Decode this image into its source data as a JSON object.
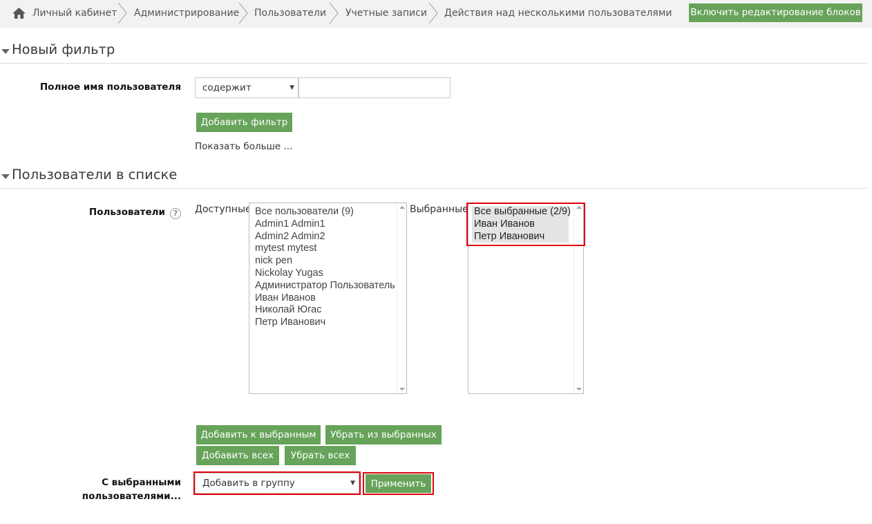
{
  "breadcrumb": {
    "items": [
      "Личный кабинет",
      "Администрирование",
      "Пользователи",
      "Учетные записи",
      "Действия над несколькими пользователями"
    ]
  },
  "header": {
    "edit_blocks_button": "Включить редактирование блоков"
  },
  "filter_section": {
    "title": "Новый фильтр",
    "fullname_label": "Полное имя пользователя",
    "operator_value": "содержит",
    "text_value": "",
    "add_filter_button": "Добавить фильтр",
    "show_more_link": "Показать больше ..."
  },
  "users_section": {
    "title": "Пользователи в списке",
    "users_label": "Пользователи",
    "available_label": "Доступные",
    "available_users": [
      "Все пользователи (9)",
      "Admin1 Admin1",
      "Admin2 Admin2",
      "mytest mytest",
      "nick pen",
      "Nickolay Yugas",
      "Администратор Пользователь",
      "Иван Иванов",
      "Николай Югас",
      "Петр Иванович"
    ],
    "selected_label": "Выбранные",
    "selected_users": [
      "Все выбранные (2/9)",
      "Иван Иванов",
      "Петр Иванович"
    ],
    "add_to_selected_button": "Добавить к выбранным",
    "remove_from_selected_button": "Убрать из выбранных",
    "add_all_button": "Добавить всех",
    "remove_all_button": "Убрать всех",
    "with_selected_label_line1": "С выбранными",
    "with_selected_label_line2": "пользователями...",
    "action_value": "Добавить в группу",
    "apply_button": "Применить"
  },
  "colors": {
    "accent_green": "#67a35a",
    "highlight_red": "#e0000b",
    "breadcrumb_bg": "#f2f2f2"
  },
  "icons": {
    "home": "home-icon",
    "chevron": "chevron-right-icon",
    "section_toggle": "caret-down-icon",
    "help": "help-icon",
    "select": "chevron-down-icon"
  }
}
